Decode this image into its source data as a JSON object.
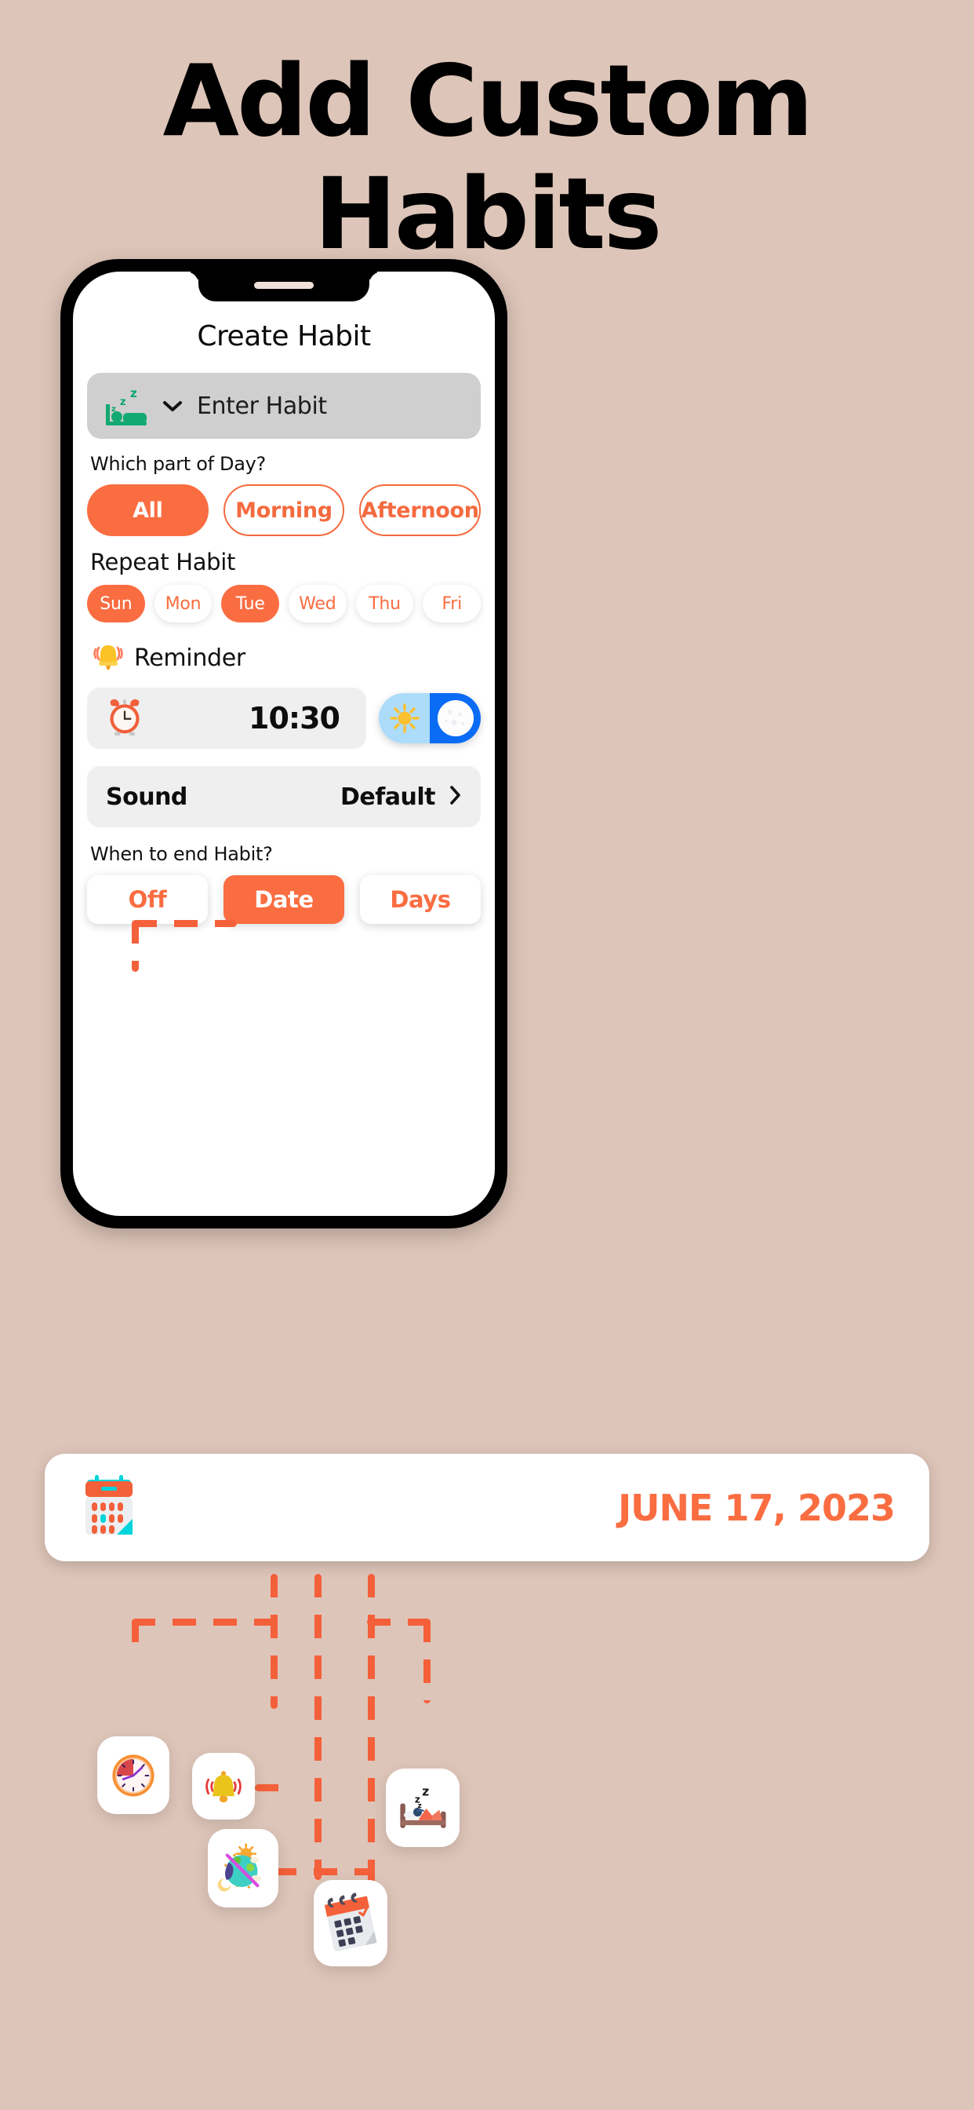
{
  "headline": {
    "line1": "Add Custom",
    "line2": "Habits"
  },
  "theme": {
    "background": "#dec5b9",
    "accent": "#f96d41",
    "accent_dark": "#f4603a",
    "toggle_on": "#0a6cf5",
    "toggle_off": "#addcfb"
  },
  "phone": {
    "screen_title": "Create Habit",
    "habit_input": {
      "placeholder": "Enter Habit",
      "icon": "sleeping-bed-icon",
      "chevron": "chevron-down-icon"
    },
    "part_of_day": {
      "label": "Which part of Day?",
      "options": [
        {
          "label": "All",
          "selected": true
        },
        {
          "label": "Morning",
          "selected": false
        },
        {
          "label": "Afternoon",
          "selected": false
        }
      ]
    },
    "repeat_habit": {
      "label": "Repeat Habit",
      "days": [
        {
          "label": "Sun",
          "selected": true
        },
        {
          "label": "Mon",
          "selected": false
        },
        {
          "label": "Tue",
          "selected": true
        },
        {
          "label": "Wed",
          "selected": false
        },
        {
          "label": "Thu",
          "selected": false
        },
        {
          "label": "Fri",
          "selected": false
        }
      ]
    },
    "reminder": {
      "label": "Reminder",
      "bell_icon": "bell-icon",
      "clock_icon": "alarm-clock-icon",
      "time": "10:30",
      "toggle": {
        "state": "on",
        "left_icon": "sun-icon",
        "right_icon": "moon-icon"
      }
    },
    "sound": {
      "label": "Sound",
      "value": "Default",
      "chevron": "chevron-right-icon"
    },
    "end_habit": {
      "label": "When to end Habit?",
      "options": [
        {
          "label": "Off",
          "selected": false
        },
        {
          "label": "Date",
          "selected": true
        },
        {
          "label": "Days",
          "selected": false
        }
      ]
    }
  },
  "date_card": {
    "icon": "tear-off-calendar-icon",
    "date": "JUNE 17, 2023"
  },
  "floating_icons": [
    {
      "name": "clock-icon"
    },
    {
      "name": "ringing-bell-icon"
    },
    {
      "name": "day-night-globe-icon"
    },
    {
      "name": "sleeping-person-bed-icon"
    },
    {
      "name": "spiral-calendar-check-icon"
    }
  ]
}
